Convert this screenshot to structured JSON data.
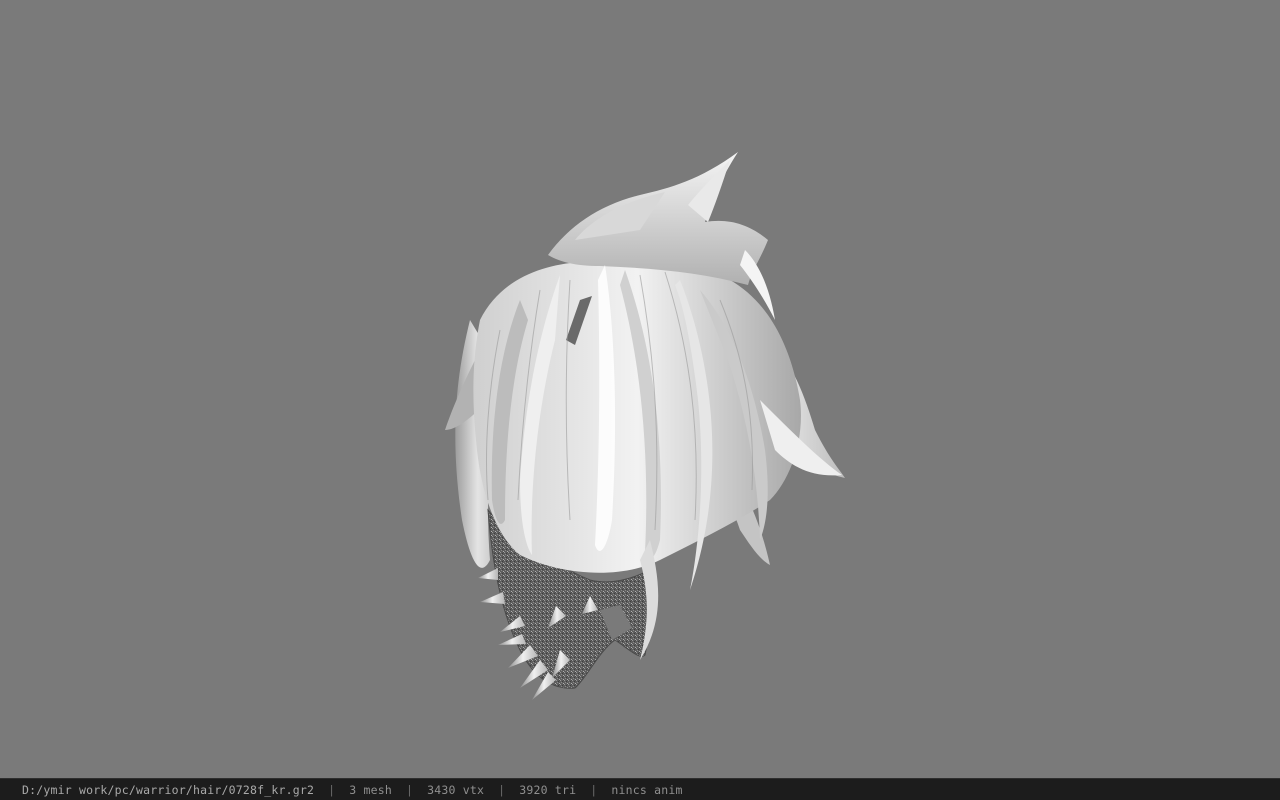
{
  "viewer": {
    "background_color": "#7a7a7a",
    "model": {
      "subject": "hair mesh",
      "icon": "hair-model"
    }
  },
  "status_bar": {
    "path": "D:/ymir work/pc/warrior/hair/0728f_kr.gr2",
    "separator": "|",
    "mesh": "3 mesh",
    "vertices": "3430 vtx",
    "triangles": "3920 tri",
    "animation": "nincs anim"
  }
}
